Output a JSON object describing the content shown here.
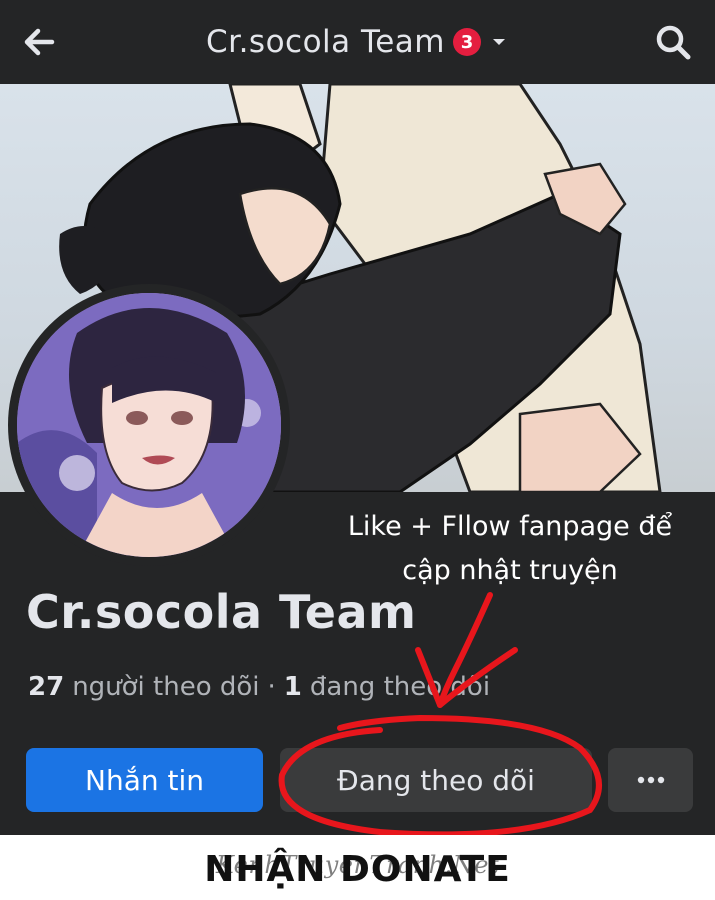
{
  "header": {
    "title": "Cr.socola Team",
    "notification_count": "3",
    "back_icon": "arrow-left-icon",
    "caret_icon": "caret-down-icon",
    "search_icon": "search-icon"
  },
  "annotation": {
    "line1": "Like + Fllow fanpage để",
    "line2": "cập nhật truyện"
  },
  "page": {
    "name": "Cr.socola Team",
    "followers_count": "27",
    "followers_label": "người theo dõi",
    "separator": "·",
    "following_count": "1",
    "following_label": "đang theo dõi"
  },
  "actions": {
    "message_label": "Nhắn tin",
    "following_label": "Đang theo dõi",
    "more_icon": "more-dots-icon"
  },
  "footer": {
    "donate": "NHẬN DONATE",
    "watermark": "KenhTruyenTranh.Net"
  },
  "colors": {
    "header_bg": "#242526",
    "primary_button": "#1b74e4",
    "secondary_button": "#3a3b3c",
    "badge": "#e41e3f",
    "annotation_red": "#e8161c"
  }
}
